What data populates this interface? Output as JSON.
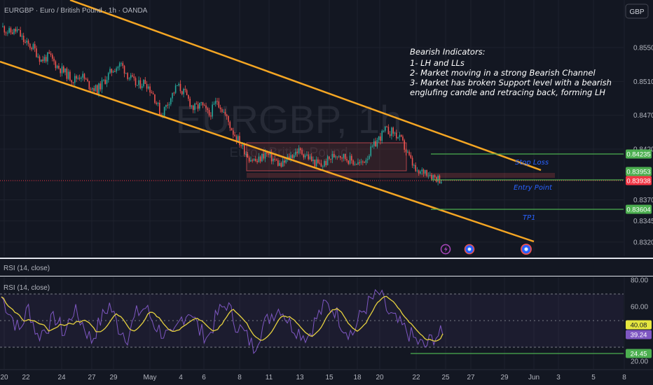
{
  "header": {
    "symbol_title": "EURGBP · Euro / British Pound · 1h · OANDA",
    "currency_button": "GBP",
    "watermark_symbol": "EURGBP, 1h",
    "watermark_name": "Euro / British Pound"
  },
  "annotation": {
    "title": "Bearish Indicators:",
    "lines": [
      "1- LH and LLs",
      "2- Market moving in a strong Bearish Channel",
      "3- Market has broken Support level with a bearish",
      "englufing candle and retracing back, forming LH"
    ]
  },
  "levels": {
    "stop_loss": {
      "label": "Stop Loss",
      "price": 0.84235
    },
    "entry": {
      "label": "Entry Point",
      "price": 0.83953
    },
    "tp1": {
      "label": "TP1",
      "price": 0.83604
    }
  },
  "chart_data": [
    {
      "type": "candlestick",
      "title": "EURGBP · Euro / British Pound · 1h · OANDA",
      "y_ticks": [
        0.855,
        0.851,
        0.847,
        0.843,
        0.837,
        0.8345,
        0.832
      ],
      "y_tick_labels": [
        "0.85500",
        "0.85100",
        "0.84700",
        "0.84200",
        "0.83700",
        "0.83450",
        "0.83200"
      ],
      "ylim": [
        0.8308,
        0.8583
      ],
      "x_tick_labels": [
        "20",
        "22",
        "24",
        "27",
        "29",
        "May",
        "4",
        "6",
        "8",
        "11",
        "13",
        "15",
        "18",
        "20",
        "22",
        "25",
        "27",
        "29",
        "Jun",
        "3",
        "5",
        "8"
      ],
      "price_tags": [
        {
          "label": "0.84235",
          "value": 0.84235,
          "color": "#4caf50"
        },
        {
          "label": "0.83953",
          "value": 0.83953,
          "color": "#4caf50"
        },
        {
          "label": "0.83938",
          "value": 0.83938,
          "color": "#f23645"
        },
        {
          "label": "0.83604",
          "value": 0.83604,
          "color": "#4caf50"
        }
      ],
      "last_price": 0.83938,
      "approx_closes": [
        0.8575,
        0.8568,
        0.857,
        0.8555,
        0.855,
        0.8535,
        0.854,
        0.8528,
        0.852,
        0.8512,
        0.8518,
        0.8505,
        0.85,
        0.8512,
        0.8525,
        0.853,
        0.8515,
        0.8505,
        0.851,
        0.8495,
        0.847,
        0.8488,
        0.8505,
        0.8495,
        0.8478,
        0.8482,
        0.847,
        0.8488,
        0.847,
        0.845,
        0.8435,
        0.842,
        0.8415,
        0.8425,
        0.8418,
        0.841,
        0.842,
        0.8428,
        0.8424,
        0.8415,
        0.841,
        0.8418,
        0.8425,
        0.842,
        0.8415,
        0.8412,
        0.8425,
        0.844,
        0.8452,
        0.845,
        0.844,
        0.842,
        0.84,
        0.8405,
        0.8398,
        0.8394
      ],
      "channel": "descending",
      "support_zone": [
        0.8398,
        0.8428
      ],
      "grid": true
    },
    {
      "type": "line",
      "title": "RSI (14, close)",
      "series": [
        {
          "name": "RSI (14, close)",
          "color": "#7e57c2"
        },
        {
          "name": "RSI (14, close)",
          "color": "#e6d13f"
        }
      ],
      "y_tick_labels": [
        "80.00",
        "60.00",
        "40.08",
        "39.24",
        "24.45",
        "20.00"
      ],
      "ylim": [
        18,
        82
      ],
      "bands": [
        30,
        70
      ],
      "approx_rsi": [
        68,
        55,
        42,
        60,
        38,
        45,
        52,
        40,
        58,
        48,
        35,
        50,
        62,
        45,
        38,
        55,
        60,
        47,
        40,
        36,
        52,
        58,
        42,
        38,
        55,
        63,
        48,
        40,
        30,
        45,
        55,
        60,
        48,
        42,
        38,
        52,
        62,
        58,
        45,
        40,
        56,
        65,
        70,
        55,
        48,
        42,
        35,
        30,
        38,
        40
      ],
      "values": {
        "rsi": 39.24,
        "ma": 40.08,
        "low_marker": 24.45
      }
    }
  ]
}
